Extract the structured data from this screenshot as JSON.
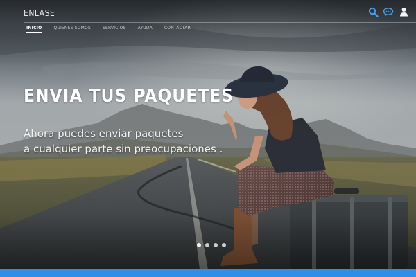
{
  "header": {
    "logo": "ENLASE",
    "nav": [
      {
        "label": "INICIO",
        "active": true
      },
      {
        "label": "QUIENES SOMOS",
        "active": false
      },
      {
        "label": "SERVICIOS",
        "active": false
      },
      {
        "label": "AYUDA",
        "active": false
      },
      {
        "label": "CONTACTAR",
        "active": false
      }
    ],
    "icons": [
      "search-icon",
      "chat-icon",
      "user-icon"
    ]
  },
  "hero": {
    "title": "ENVIA TUS PAQUETES",
    "subtitle_line1": "Ahora puedes enviar paquetes",
    "subtitle_line2": "a cualquier parte sin preocupaciones ."
  },
  "slider": {
    "dot_count": 4,
    "active_index": 0
  },
  "colors": {
    "accent_bar": "#2e8ee8",
    "icon_blue": "#4a9ee0",
    "text_white": "#ffffff"
  }
}
